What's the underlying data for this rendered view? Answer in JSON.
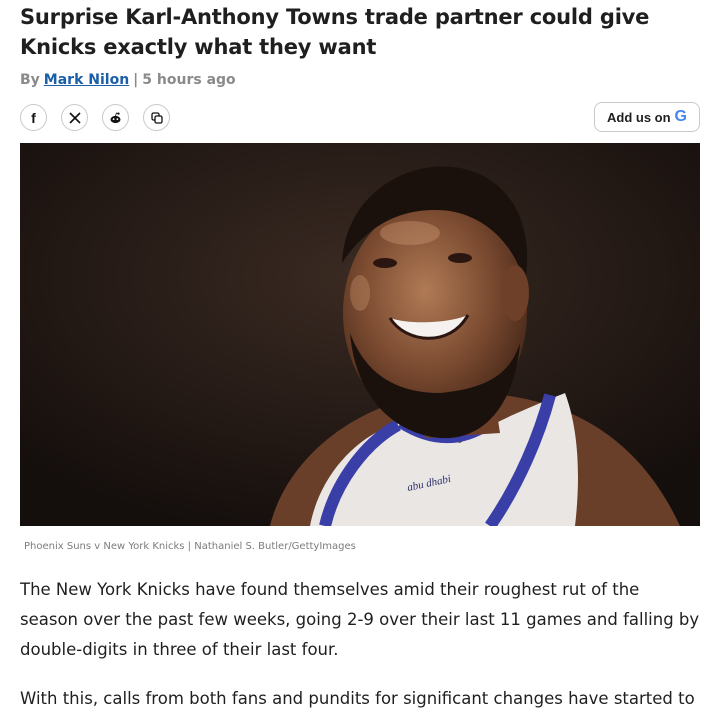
{
  "article": {
    "headline": "Surprise Karl-Anthony Towns trade partner could give Knicks exactly what they want",
    "byline_prefix": "By",
    "author": "Mark Nilon",
    "separator": "|",
    "time_ago": "5 hours ago",
    "add_google_label": "Add us on",
    "add_google_glyph": "G",
    "image_caption": "Phoenix Suns v New York Knicks | Nathaniel S. Butler/GettyImages",
    "jersey_text": "abu dhabi",
    "paragraphs": [
      "The New York Knicks have found themselves amid their roughest rut of the season over the past few weeks, going 2-9 over their last 11 games and falling by double-digits in three of their last four.",
      "With this, calls from both fans and pundits for significant changes have started to"
    ]
  },
  "share": {
    "facebook_glyph": "f",
    "x_glyph": "𝕏",
    "icons": [
      "facebook-icon",
      "x-icon",
      "reddit-icon",
      "copy-link-icon"
    ]
  },
  "colors": {
    "link": "#1b5fa8",
    "muted": "#8a8a8a",
    "google_blue": "#4285f4"
  }
}
